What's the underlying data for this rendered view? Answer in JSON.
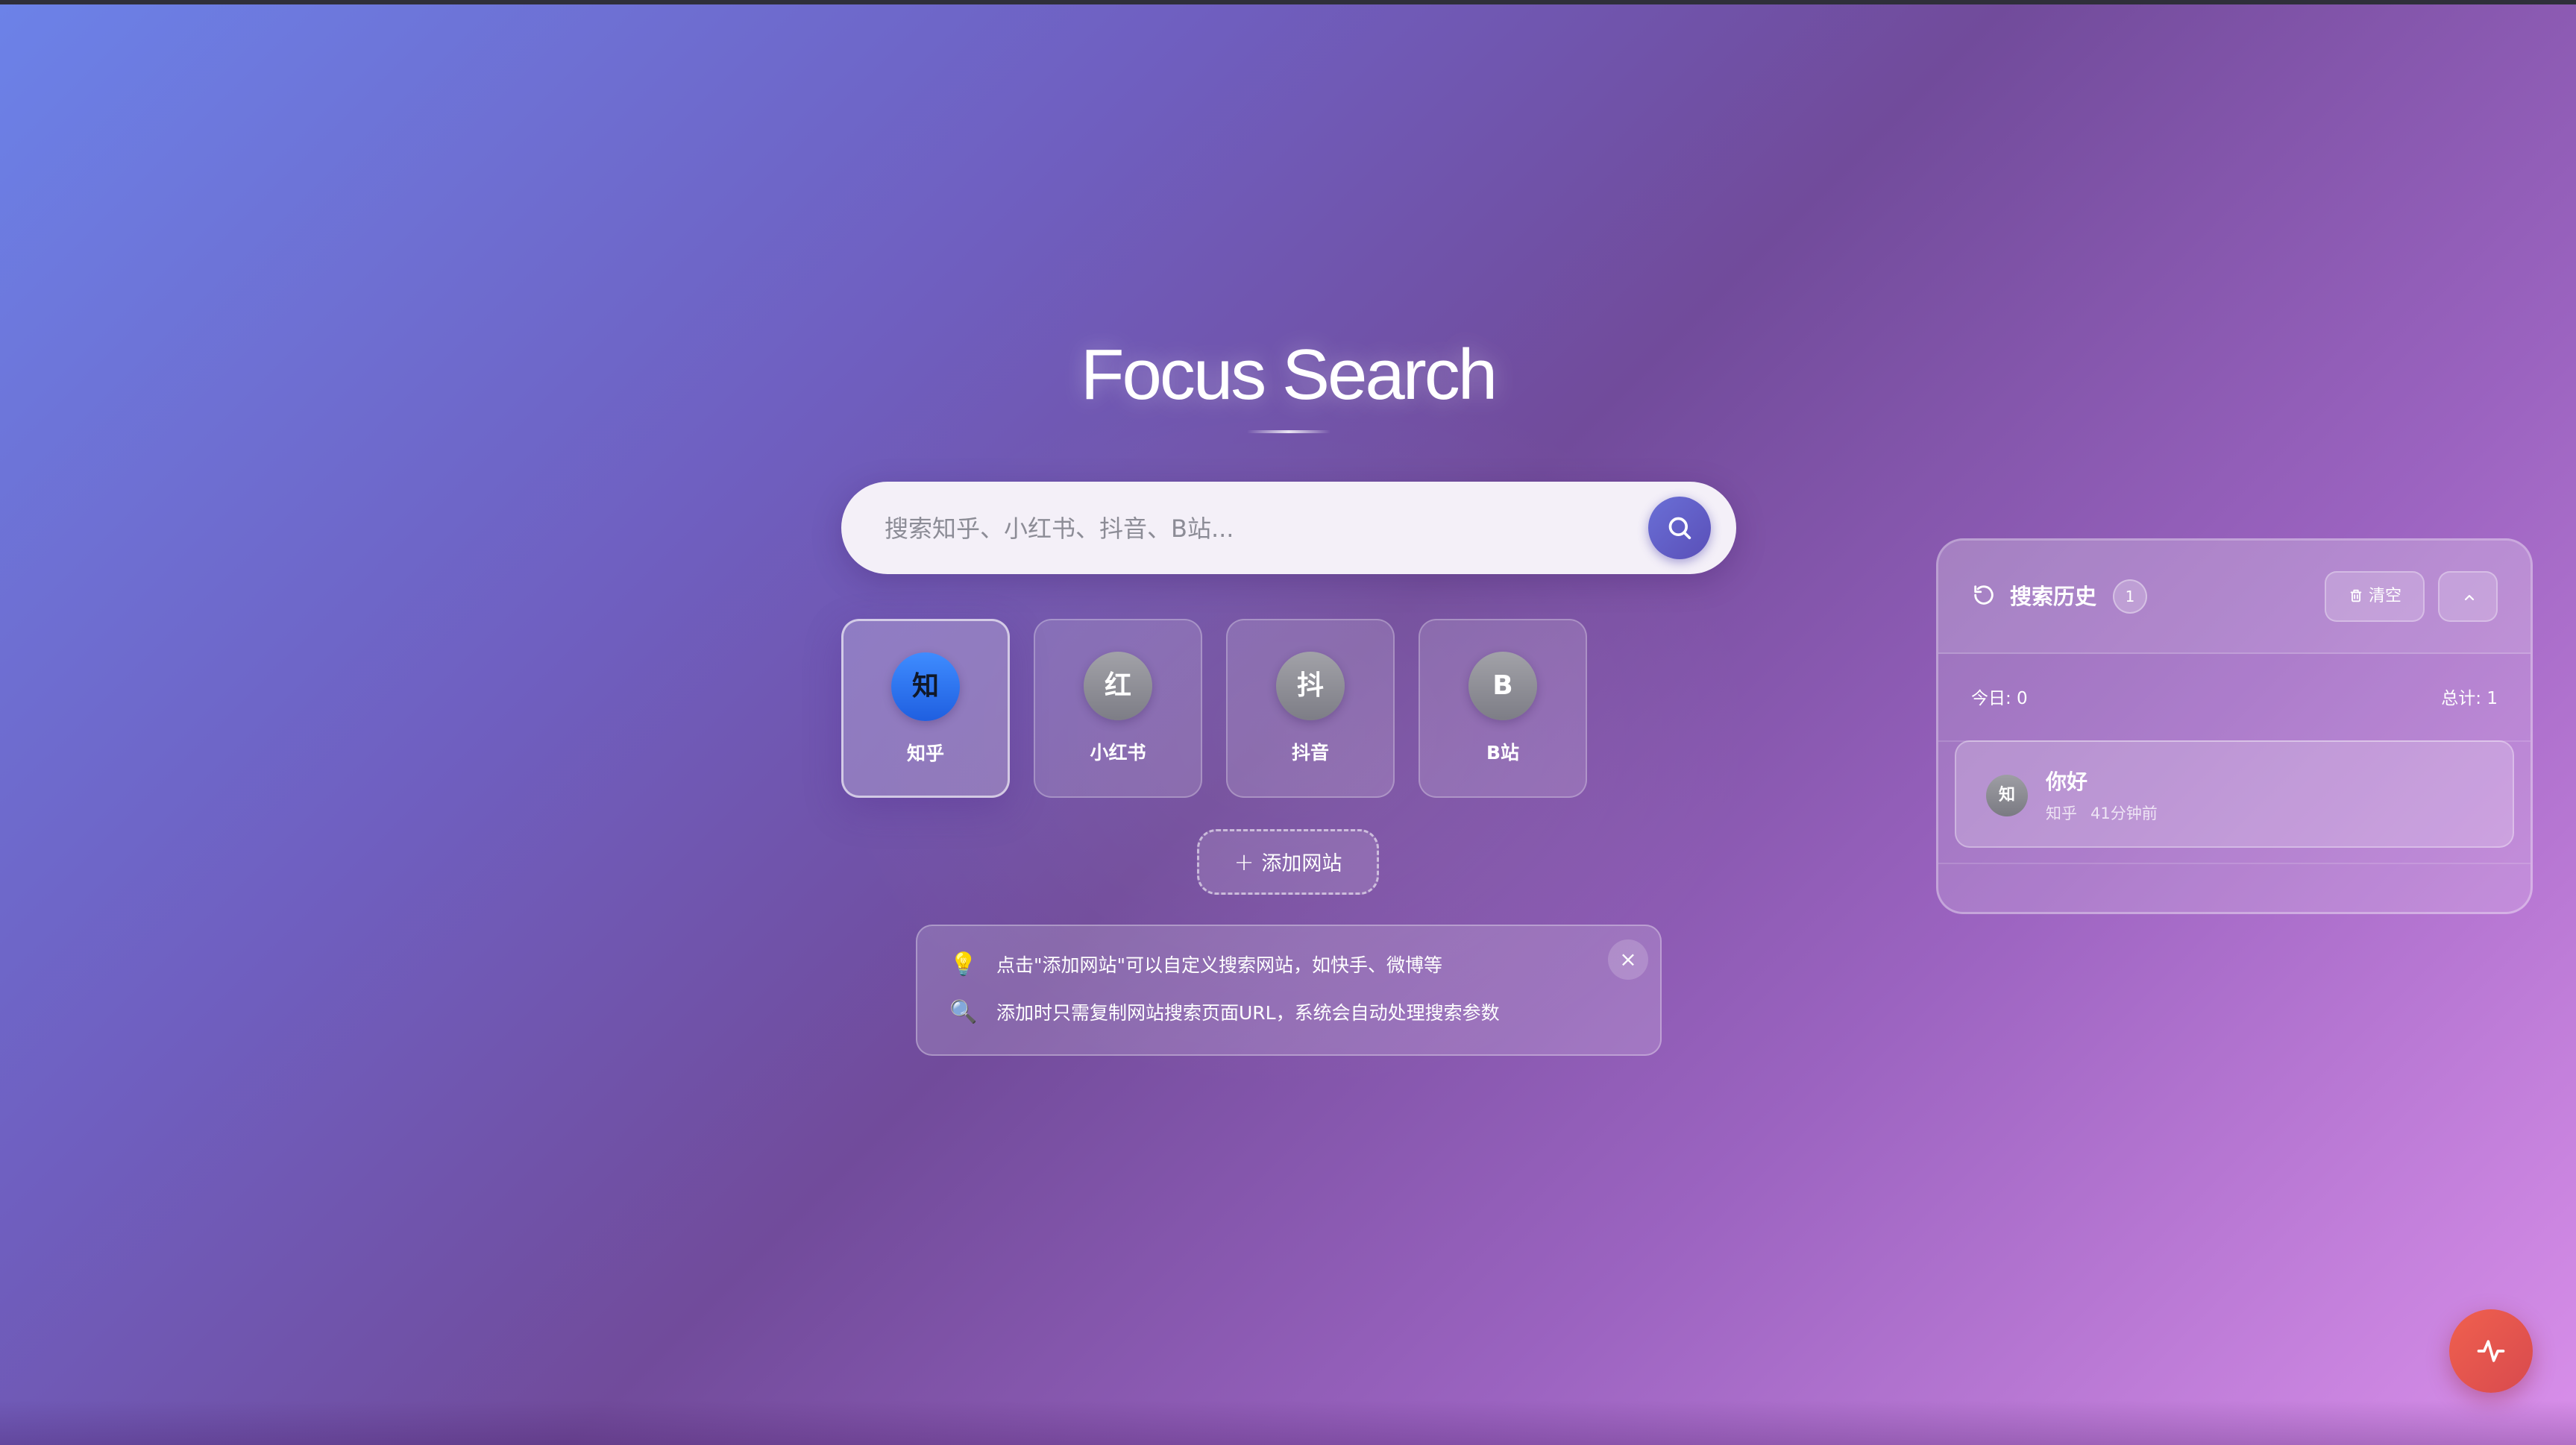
{
  "app": {
    "title": "Focus Search"
  },
  "search": {
    "placeholder": "搜索知乎、小红书、抖音、B站...",
    "value": "",
    "button_icon": "search-icon"
  },
  "sites": [
    {
      "id": "zhihu",
      "avatar": "知",
      "label": "知乎",
      "active": true,
      "color": "#2f7cf6"
    },
    {
      "id": "xiaohongshu",
      "avatar": "红",
      "label": "小红书",
      "active": false
    },
    {
      "id": "douyin",
      "avatar": "抖",
      "label": "抖音",
      "active": false
    },
    {
      "id": "bilibili",
      "avatar": "B",
      "label": "B站",
      "active": false
    }
  ],
  "add_site": {
    "icon": "+",
    "label": "添加网站"
  },
  "tips": {
    "items": [
      {
        "icon": "💡",
        "icon_name": "lightbulb-icon",
        "text": "点击\"添加网站\"可以自定义搜索网站，如快手、微博等"
      },
      {
        "icon": "🔍",
        "icon_name": "magnifier-icon",
        "text": "添加时只需复制网站搜索页面URL，系统会自动处理搜索参数"
      }
    ],
    "close_icon": "×"
  },
  "history": {
    "title": "搜索历史",
    "count": "1",
    "clear_label": "清空",
    "stats": {
      "today": "今日: 0",
      "total": "总计: 1"
    },
    "items": [
      {
        "avatar": "知",
        "query": "你好",
        "site": "知乎",
        "time": "41分钟前"
      }
    ]
  },
  "colors": {
    "accent": "#5a4fb8",
    "fab": "#e85a4f",
    "active_site": "#2f7cf6"
  }
}
